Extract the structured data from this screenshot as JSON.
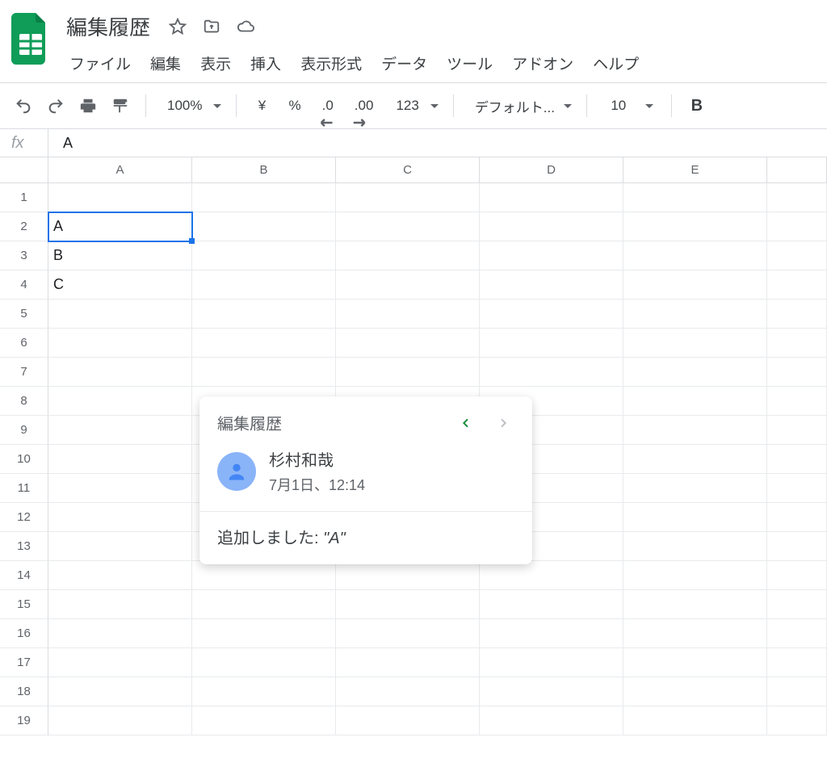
{
  "doc": {
    "title": "編集履歴"
  },
  "menu": {
    "items": [
      "ファイル",
      "編集",
      "表示",
      "挿入",
      "表示形式",
      "データ",
      "ツール",
      "アドオン",
      "ヘルプ"
    ]
  },
  "toolbar": {
    "zoom": "100%",
    "currency_symbol": "¥",
    "percent_symbol": "%",
    "decrease_decimal": ".0",
    "increase_decimal": ".00",
    "format_more": "123",
    "font": "デフォルト...",
    "font_size": "10"
  },
  "formula": {
    "label": "fx",
    "value": "A"
  },
  "grid": {
    "columns": [
      "A",
      "B",
      "C",
      "D",
      "E"
    ],
    "row_count": 19,
    "cells": {
      "A2": "A",
      "A3": "B",
      "A4": "C"
    },
    "selected": "A2"
  },
  "popup": {
    "title": "編集履歴",
    "user_name": "杉村和哉",
    "timestamp": "7月1日、12:14",
    "change_prefix": "追加しました: ",
    "change_value": "\"A\"",
    "prev_enabled": true,
    "next_enabled": false
  }
}
